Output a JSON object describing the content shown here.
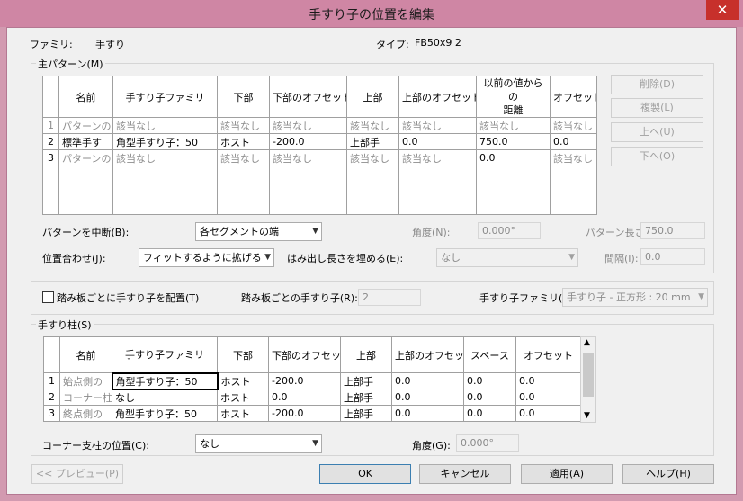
{
  "window": {
    "title": "手すり子の位置を編集",
    "close_glyph": "✕"
  },
  "header": {
    "family_label": "ファミリ:",
    "family_value": "手すり",
    "type_label": "タイプ:",
    "type_value": "FB50x9 2"
  },
  "main_pattern": {
    "group_label": "主パターン(M)",
    "columns": [
      "名前",
      "手すり子ファミリ",
      "下部",
      "下部のオフセット",
      "上部",
      "上部のオフセット",
      "以前の値からの距離",
      "オフセット"
    ],
    "column_line1": "以前の値からの",
    "column_line2": "距離",
    "rows": [
      [
        "1",
        "パターンの",
        "該当なし",
        "該当なし",
        "該当なし",
        "該当なし",
        "該当なし",
        "該当なし",
        "該当なし"
      ],
      [
        "2",
        "標準手す",
        "角型手すり子：50",
        "ホスト",
        "-200.0",
        "上部手",
        "0.0",
        "750.0",
        "0.0"
      ],
      [
        "3",
        "パターンの",
        "該当なし",
        "該当なし",
        "該当なし",
        "該当なし",
        "該当なし",
        "0.0",
        "該当なし"
      ]
    ],
    "buttons": {
      "delete": "削除(D)",
      "duplicate": "複製(L)",
      "up": "上へ(U)",
      "down": "下へ(O)"
    },
    "break_label": "パターンを中断(B):",
    "break_value": "各セグメントの端",
    "angle_label": "角度(N):",
    "angle_value": "0.000°",
    "length_label": "パターン長さ:",
    "length_value": "750.0",
    "justify_label": "位置合わせ(J):",
    "justify_value": "フィットするように拡げる",
    "excess_label": "はみ出し長さを埋める(E):",
    "excess_value": "なし",
    "spacing_label": "間隔(I):",
    "spacing_value": "0.0"
  },
  "tread": {
    "checkbox_label": "踏み板ごとに手すり子を配置(T)",
    "per_tread_label": "踏み板ごとの手すり子(R):",
    "per_tread_value": "2",
    "family_label": "手すり子ファミリ(F):",
    "family_value": "手すり子 - 正方形 : 20 mm"
  },
  "posts": {
    "group_label": "手すり柱(S)",
    "columns": [
      "名前",
      "手すり子ファミリ",
      "下部",
      "下部のオフセット",
      "上部",
      "上部のオフセット",
      "スペース",
      "オフセット"
    ],
    "rows": [
      [
        "1",
        "始点側の",
        "角型手すり子：50",
        "ホスト",
        "-200.0",
        "上部手",
        "0.0",
        "0.0",
        "0.0"
      ],
      [
        "2",
        "コーナー柱",
        "なし",
        "ホスト",
        "0.0",
        "上部手",
        "0.0",
        "0.0",
        "0.0"
      ],
      [
        "3",
        "終点側の",
        "角型手すり子：50",
        "ホスト",
        "-200.0",
        "上部手",
        "0.0",
        "0.0",
        "0.0"
      ]
    ],
    "corner_label": "コーナー支柱の位置(C):",
    "corner_value": "なし",
    "angle_label": "角度(G):",
    "angle_value": "0.000°"
  },
  "footer": {
    "preview": "<< プレビュー(P)",
    "ok": "OK",
    "cancel": "キャンセル",
    "apply": "適用(A)",
    "help": "ヘルプ(H)"
  },
  "colors": {
    "titlebar": "#cf86a4",
    "close": "#c7302b",
    "focus": "#3c7fb1"
  }
}
